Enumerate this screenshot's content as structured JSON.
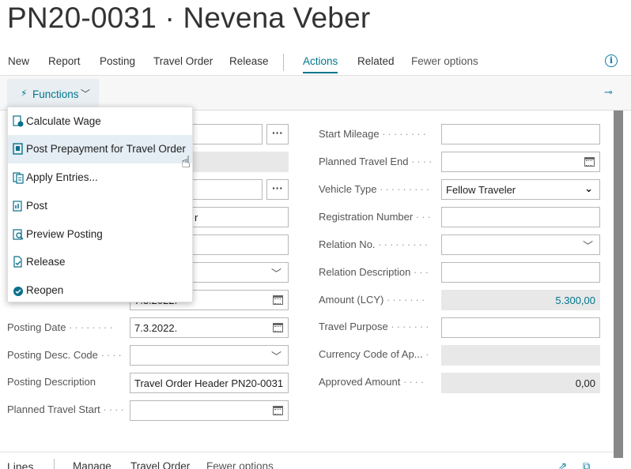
{
  "page": {
    "title": "PN20-0031 · Nevena Veber"
  },
  "actions": {
    "items": [
      "New",
      "Report",
      "Posting",
      "Travel Order",
      "Release"
    ],
    "tabs": [
      "Actions",
      "Related",
      "Fewer options"
    ]
  },
  "functions": {
    "label": "Functions"
  },
  "menu": {
    "items": [
      {
        "label": "Calculate Wage",
        "icon": "calculate-wage-icon"
      },
      {
        "label": "Post Prepayment for Travel Order",
        "icon": "post-prepayment-icon",
        "highlighted": true
      },
      {
        "label": "Apply Entries...",
        "icon": "apply-entries-icon"
      },
      {
        "label": "Post",
        "icon": "post-icon"
      },
      {
        "label": "Preview Posting",
        "icon": "preview-posting-icon"
      },
      {
        "label": "Release",
        "icon": "release-icon"
      },
      {
        "label": "Reopen",
        "icon": "reopen-icon"
      }
    ]
  },
  "left_fields": {
    "employee_name_partial": "r",
    "document_date_partial": "7.3.2022.",
    "posting_date": {
      "label": "Posting Date",
      "value": "7.3.2022."
    },
    "posting_desc_code": {
      "label": "Posting Desc. Code",
      "value": ""
    },
    "posting_description": {
      "label": "Posting Description",
      "value": "Travel Order Header PN20-0031"
    },
    "planned_travel_start": {
      "label": "Planned Travel Start",
      "value": ""
    }
  },
  "right_fields": {
    "start_mileage": {
      "label": "Start Mileage",
      "value": ""
    },
    "planned_travel_end": {
      "label": "Planned Travel End",
      "value": ""
    },
    "vehicle_type": {
      "label": "Vehicle Type",
      "value": "Fellow Traveler"
    },
    "registration_number": {
      "label": "Registration Number",
      "value": ""
    },
    "relation_no": {
      "label": "Relation No.",
      "value": ""
    },
    "relation_description": {
      "label": "Relation Description",
      "value": ""
    },
    "amount_lcy": {
      "label": "Amount (LCY)",
      "value": "5.300,00"
    },
    "travel_purpose": {
      "label": "Travel Purpose",
      "value": ""
    },
    "currency_code": {
      "label": "Currency Code of Ap...",
      "value": ""
    },
    "approved_amount": {
      "label": "Approved Amount",
      "value": "0,00"
    }
  },
  "lines": {
    "title": "Lines",
    "items": [
      "Manage",
      "Travel Order",
      "Fewer options"
    ]
  },
  "colors": {
    "accent": "#00768c",
    "highlight": "#e4eef4",
    "readonly": "#e8e8e8"
  }
}
